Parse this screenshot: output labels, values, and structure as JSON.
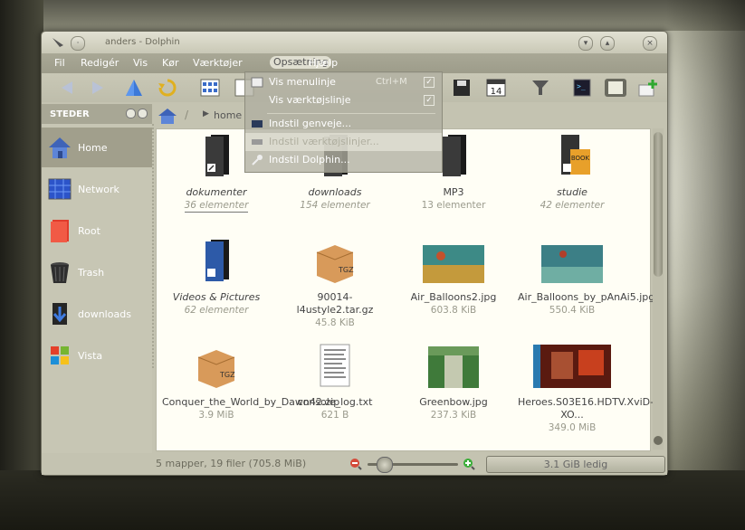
{
  "window": {
    "title": "anders - Dolphin"
  },
  "menubar": [
    "Fil",
    "Redigér",
    "Vis",
    "Kør",
    "Værktøjer",
    "Opsætning",
    "Hjælp"
  ],
  "dropdown": {
    "items": [
      {
        "label": "Vis menulinje",
        "shortcut": "Ctrl+M",
        "checked": true
      },
      {
        "label": "Vis værktøjslinje",
        "checked": true
      },
      {
        "label": "Indstil genveje..."
      },
      {
        "label": "Indstil værktøjslinjer..."
      },
      {
        "label": "Indstil Dolphin..."
      }
    ]
  },
  "sidebar": {
    "header": "STEDER",
    "items": [
      {
        "label": "Home",
        "icon": "home-icon",
        "selected": true
      },
      {
        "label": "Network",
        "icon": "network-icon"
      },
      {
        "label": "Root",
        "icon": "root-folder-icon"
      },
      {
        "label": "Trash",
        "icon": "trash-icon"
      },
      {
        "label": "downloads",
        "icon": "downloads-icon"
      },
      {
        "label": "Vista",
        "icon": "vista-icon"
      }
    ]
  },
  "breadcrumb": {
    "current": "home"
  },
  "files": [
    {
      "name": "dokumenter",
      "meta": "36 elementer",
      "italic": true,
      "icon": "folder-icon"
    },
    {
      "name": "downloads",
      "meta": "154 elementer",
      "italic": true,
      "icon": "folder-icon"
    },
    {
      "name": "MP3",
      "meta": "13 elementer",
      "italic": false,
      "icon": "folder-icon"
    },
    {
      "name": "studie",
      "meta": "42 elementer",
      "italic": true,
      "icon": "book-folder-icon"
    },
    {
      "name": "Videos & Pictures",
      "meta": "62 elementer",
      "italic": true,
      "icon": "folder-icon"
    },
    {
      "name": "90014-l4ustyle2.tar.gz",
      "meta": "45.8 KiB",
      "italic": false,
      "icon": "archive-icon"
    },
    {
      "name": "Air_Balloons2.jpg",
      "meta": "603.8 KiB",
      "italic": false,
      "icon": "image-thumbnail"
    },
    {
      "name": "Air_Balloons_by_pAnAi5.jpg",
      "meta": "550.4 KiB",
      "italic": false,
      "icon": "image-thumbnail"
    },
    {
      "name": "Conquer_the_World_by_Dawn42.zip",
      "meta": "3.9 MiB",
      "italic": false,
      "icon": "archive-icon"
    },
    {
      "name": "console_log.txt",
      "meta": "621 B",
      "italic": false,
      "icon": "text-file-icon"
    },
    {
      "name": "Greenbow.jpg",
      "meta": "237.3 KiB",
      "italic": false,
      "icon": "image-thumbnail"
    },
    {
      "name": "Heroes.S03E16.HDTV.XviD-XO...",
      "meta": "349.0 MiB",
      "italic": false,
      "icon": "video-thumbnail"
    }
  ],
  "status": {
    "summary": "5 mapper, 19 filer (705.8 MiB)",
    "free": "3.1 GiB ledig",
    "zoom_fraction": 0.18
  }
}
